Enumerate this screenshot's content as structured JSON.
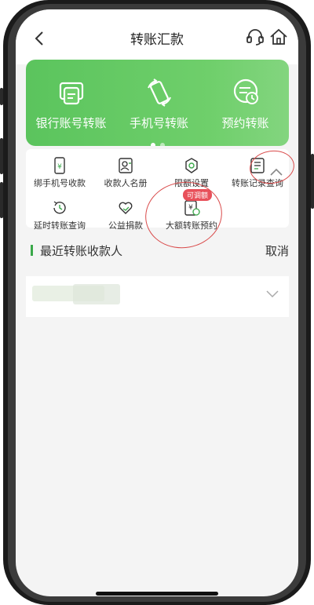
{
  "header": {
    "title": "转账汇款"
  },
  "banner": {
    "items": [
      {
        "label": "银行账号转账",
        "icon": "bank-card-icon"
      },
      {
        "label": "手机号转账",
        "icon": "phone-rotate-icon"
      },
      {
        "label": "预约转账",
        "icon": "clock-card-icon"
      }
    ]
  },
  "functions": {
    "items": [
      {
        "label": "绑手机号收款"
      },
      {
        "label": "收款人名册"
      },
      {
        "label": "限额设置"
      },
      {
        "label": "转账记录查询"
      },
      {
        "label": "延时转账查询"
      },
      {
        "label": "公益捐款"
      },
      {
        "label": "大额转账预约",
        "badge": "可调额"
      }
    ]
  },
  "recent": {
    "title": "最近转账收款人",
    "cancel": "取消"
  },
  "colors": {
    "brand_green": "#5bc45d",
    "badge_red": "#e8505a",
    "annotation_red": "#d94a4a"
  }
}
